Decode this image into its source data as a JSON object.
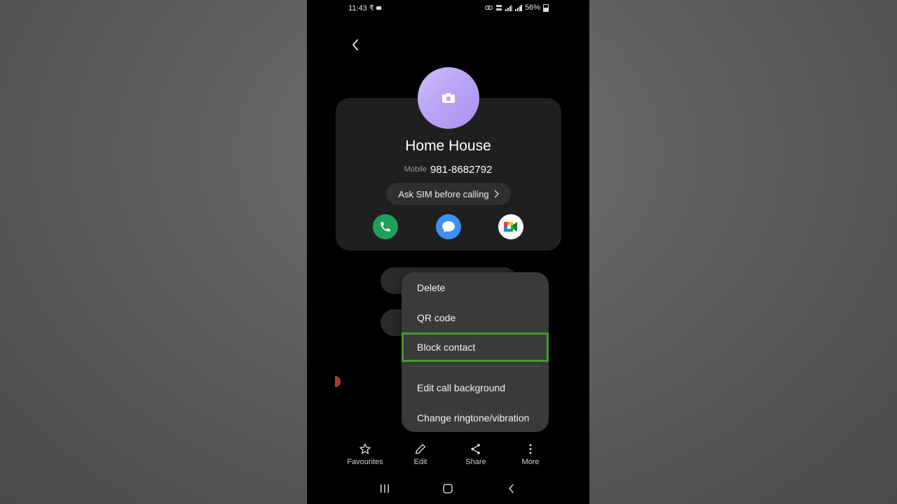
{
  "status": {
    "time": "11:43",
    "currency": "₹",
    "battery": "56%"
  },
  "contact": {
    "name": "Home House",
    "phone_label": "Mobile",
    "phone_number": "981-8682792",
    "sim_button": "Ask SIM before calling"
  },
  "menu": {
    "items": [
      "Delete",
      "QR code",
      "Block contact",
      "Edit call background",
      "Change ringtone/vibration"
    ],
    "highlighted": "Block contact"
  },
  "bottombar": {
    "favourites": "Favourites",
    "edit": "Edit",
    "share": "Share",
    "more": "More"
  },
  "colors": {
    "call": "#1fa05a",
    "message": "#3d8ff0",
    "avatar": "#b8a2f5",
    "highlight": "#3f9e2b"
  }
}
